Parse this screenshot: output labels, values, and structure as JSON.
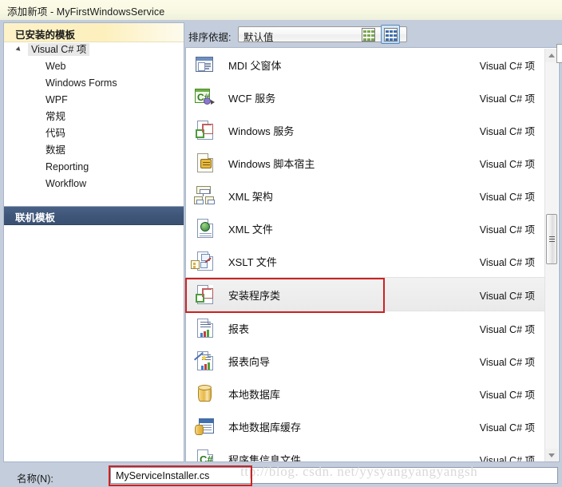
{
  "window": {
    "title": "添加新项 - MyFirstWindowsService"
  },
  "left_pane": {
    "header": "已安装的模板",
    "tree": [
      {
        "label": "Visual C# 项",
        "level": 0,
        "expanded": true,
        "selected": true
      },
      {
        "label": "Web",
        "level": 1
      },
      {
        "label": "Windows Forms",
        "level": 1
      },
      {
        "label": "WPF",
        "level": 1
      },
      {
        "label": "常规",
        "level": 1
      },
      {
        "label": "代码",
        "level": 1
      },
      {
        "label": "数据",
        "level": 1
      },
      {
        "label": "Reporting",
        "level": 1
      },
      {
        "label": "Workflow",
        "level": 1
      }
    ],
    "online_templates": "联机模板"
  },
  "toolbar": {
    "sort_label": "排序依据:",
    "sort_value": "默认值",
    "view_small_icon": "small-icons-view-icon",
    "view_large_icon": "large-icons-view-icon",
    "view_selected": "large"
  },
  "list": {
    "items": [
      {
        "name": "MDI 父窗体",
        "kind": "Visual C# 项",
        "icon": "mdi-parent-form-icon",
        "selected": false
      },
      {
        "name": "WCF 服务",
        "kind": "Visual C# 项",
        "icon": "wcf-service-icon",
        "selected": false
      },
      {
        "name": "Windows 服务",
        "kind": "Visual C# 项",
        "icon": "windows-service-icon",
        "selected": false
      },
      {
        "name": "Windows 脚本宿主",
        "kind": "Visual C# 项",
        "icon": "windows-script-host-icon",
        "selected": false
      },
      {
        "name": "XML 架构",
        "kind": "Visual C# 项",
        "icon": "xml-schema-icon",
        "selected": false
      },
      {
        "name": "XML 文件",
        "kind": "Visual C# 项",
        "icon": "xml-file-icon",
        "selected": false
      },
      {
        "name": "XSLT 文件",
        "kind": "Visual C# 项",
        "icon": "xslt-file-icon",
        "selected": false
      },
      {
        "name": "安装程序类",
        "kind": "Visual C# 项",
        "icon": "installer-class-icon",
        "selected": true
      },
      {
        "name": "报表",
        "kind": "Visual C# 项",
        "icon": "report-icon",
        "selected": false
      },
      {
        "name": "报表向导",
        "kind": "Visual C# 项",
        "icon": "report-wizard-icon",
        "selected": false
      },
      {
        "name": "本地数据库",
        "kind": "Visual C# 项",
        "icon": "local-database-icon",
        "selected": false
      },
      {
        "name": "本地数据库缓存",
        "kind": "Visual C# 项",
        "icon": "local-database-cache-icon",
        "selected": false
      },
      {
        "name": "程序集信息文件",
        "kind": "Visual C# 项",
        "icon": "assembly-information-file-icon",
        "selected": false
      }
    ]
  },
  "bottom": {
    "name_label": "名称(N):",
    "name_value": "MyServiceInstaller.cs"
  },
  "watermark": {
    "text": "http://blog. csdn. net/yysyangyangyangsh"
  },
  "colors": {
    "dialog_background": "#c3cddc",
    "title_background": "#fbfbe8",
    "installed_header": "#fdf0bd",
    "online_bar": "#3f5679",
    "annotation_red": "#cc2222",
    "selection_border": "#5b87b8"
  }
}
